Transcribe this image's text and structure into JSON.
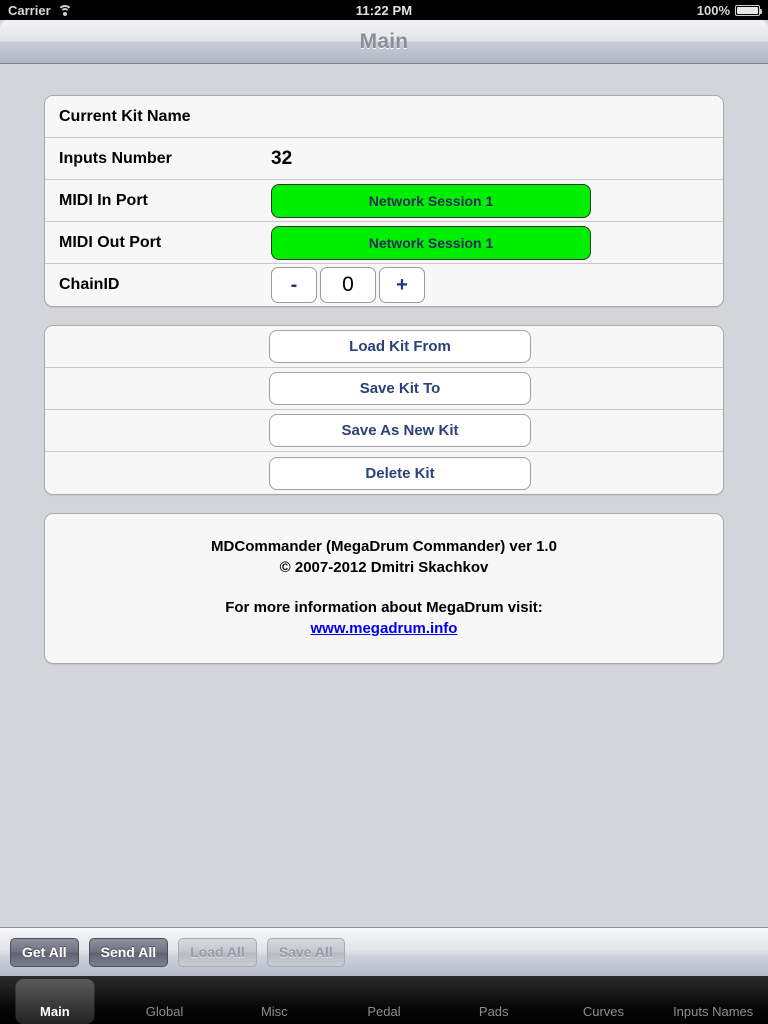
{
  "status_bar": {
    "carrier": "Carrier",
    "wifi_icon": "wifi-icon",
    "time": "11:22 PM",
    "battery_percent": "100%",
    "battery_icon": "battery-full-icon"
  },
  "nav_bar": {
    "title": "Main"
  },
  "settings_group": {
    "rows": [
      {
        "label": "Current Kit Name",
        "type": "text",
        "value": ""
      },
      {
        "label": "Inputs Number",
        "type": "text",
        "value": "32"
      },
      {
        "label": "MIDI In Port",
        "type": "port",
        "value": "Network Session 1",
        "color": "#00ee00"
      },
      {
        "label": "MIDI Out Port",
        "type": "port",
        "value": "Network Session 1",
        "color": "#00ee00"
      },
      {
        "label": "ChainID",
        "type": "stepper",
        "value": "0",
        "decrement_label": "-",
        "increment_label": "+"
      }
    ]
  },
  "kit_actions": {
    "buttons": [
      {
        "label": "Load Kit From"
      },
      {
        "label": "Save Kit To"
      },
      {
        "label": "Save As New Kit"
      },
      {
        "label": "Delete Kit"
      }
    ]
  },
  "about_panel": {
    "line1": "MDCommander (MegaDrum Commander) ver 1.0",
    "line2": "© 2007-2012 Dmitri Skachkov",
    "line3": "For more information about MegaDrum visit:",
    "link": "www.megadrum.info",
    "link_color": "#0000ee"
  },
  "toolbar": {
    "buttons": [
      {
        "label": "Get All",
        "enabled": true
      },
      {
        "label": "Send All",
        "enabled": true
      },
      {
        "label": "Load All",
        "enabled": false
      },
      {
        "label": "Save All",
        "enabled": false
      }
    ]
  },
  "tab_bar": {
    "selected": "Main",
    "tabs": [
      {
        "label": "Main"
      },
      {
        "label": "Global"
      },
      {
        "label": "Misc"
      },
      {
        "label": "Pedal"
      },
      {
        "label": "Pads"
      },
      {
        "label": "Curves"
      },
      {
        "label": "Inputs Names"
      }
    ]
  }
}
